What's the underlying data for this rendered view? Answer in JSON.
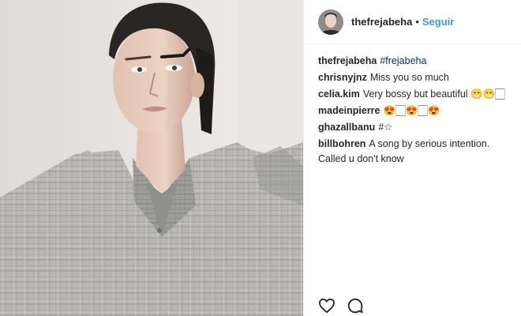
{
  "post": {
    "author": "thefrejabeha",
    "separator": "•",
    "follow_label": "Seguir",
    "photo_icon": "portrait-photo"
  },
  "comments": [
    {
      "user": "thefrejabeha",
      "text": "",
      "tag": "#frejabeha"
    },
    {
      "user": "chrisnyjnz",
      "text": "Miss you so much",
      "tag": ""
    },
    {
      "user": "celia.kim",
      "text": "Very bossy but beautiful 😁😁🏻",
      "tag": ""
    },
    {
      "user": "madeinpierre",
      "text": "😍🏻😍🏻😍",
      "tag": ""
    },
    {
      "user": "ghazallbanu",
      "text": "#☆",
      "tag": ""
    },
    {
      "user": "billbohren",
      "text": "A song by serious intention. Called u don't know",
      "tag": ""
    }
  ],
  "actions": {
    "like_icon": "heart-icon",
    "comment_icon": "comment-bubble-icon"
  },
  "colors": {
    "link_blue": "#3897f0",
    "hashtag": "#003569",
    "text": "#262626",
    "divider": "#efefef"
  }
}
